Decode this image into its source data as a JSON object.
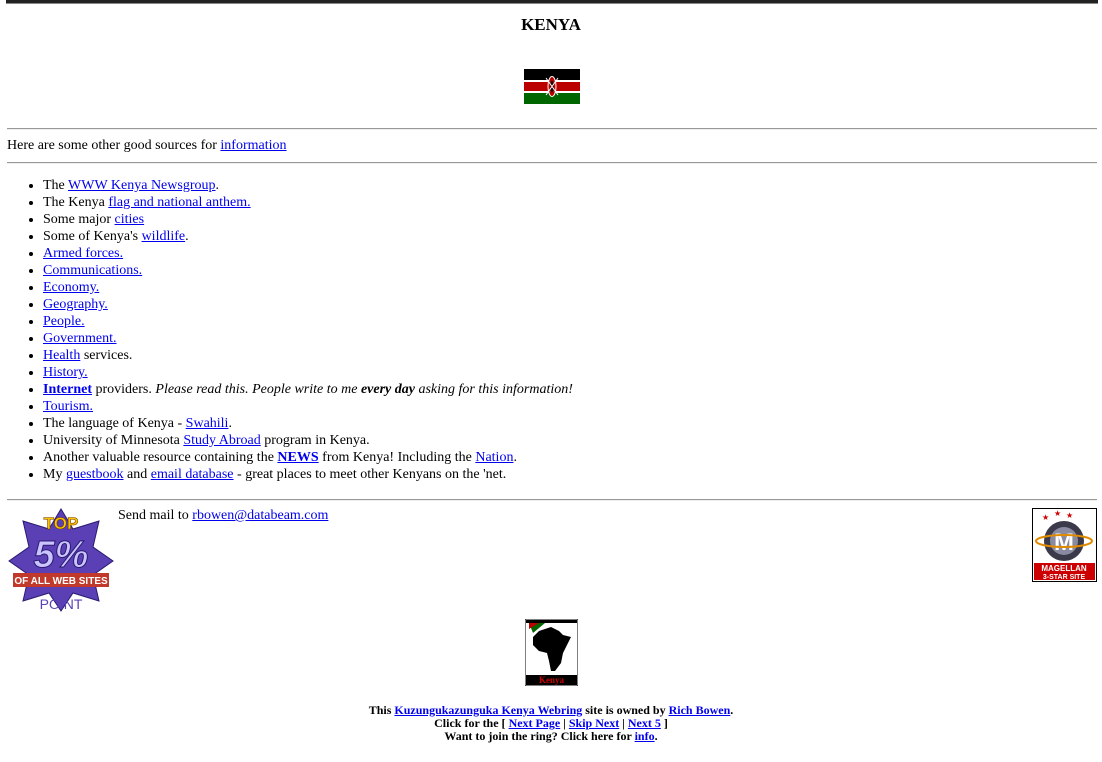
{
  "page": {
    "title": "KENYA"
  },
  "intro": {
    "text": "Here are some other good sources for ",
    "link": "information"
  },
  "sources": {
    "item1": {
      "pre": "The ",
      "link": "WWW Kenya Newsgroup",
      "post": "."
    },
    "item2": {
      "pre": "The Kenya ",
      "link": "flag and national anthem."
    },
    "item3": {
      "pre": "Some major ",
      "link": "cities"
    },
    "item4": {
      "pre": "Some of Kenya's ",
      "link": "wildlife",
      "post": "."
    },
    "item5": {
      "link": "Armed forces."
    },
    "item6": {
      "link": "Communications."
    },
    "item7": {
      "link": "Economy."
    },
    "item8": {
      "link": "Geography."
    },
    "item9": {
      "link": "People."
    },
    "item10": {
      "link": "Government."
    },
    "item11": {
      "link": "Health",
      "post": " services."
    },
    "item12": {
      "link": "History."
    },
    "item13": {
      "link": "Internet",
      "post": " providers. ",
      "italic1": "Please read this. People write to me ",
      "bold_italic": "every day",
      "italic2": " asking for this information!"
    },
    "item14": {
      "link": "Tourism."
    },
    "item15": {
      "pre": "The language of Kenya - ",
      "link": "Swahili",
      "post": "."
    },
    "item16": {
      "pre": "University of Minnesota ",
      "link": "Study Abroad",
      "post": " program in Kenya."
    },
    "item17": {
      "pre": "Another valuable resource containing the ",
      "link": "NEWS",
      "mid": " from Kenya! Including the ",
      "link2": "Nation",
      "post": "."
    },
    "item18": {
      "pre": "My ",
      "link": "guestbook",
      "mid": " and ",
      "link2": "email database",
      "post": " - great places to meet other Kenyans on the 'net."
    }
  },
  "contact": {
    "text": "Send mail to ",
    "email": "rbowen@databeam.com"
  },
  "badges": {
    "top5_line1": "TOP",
    "top5_line2": "5%",
    "top5_line3": "OF ALL WEB SITES",
    "top5_line4": "POINT",
    "magellan_line1": "MAGELLAN",
    "magellan_line2": "3-STAR SITE",
    "africa_label": "Kenya"
  },
  "footer": {
    "line1_pre": "This ",
    "ring_link": "Kuzungukazunguka Kenya Webring",
    "line1_mid": " site is owned by ",
    "owner_link": "Rich Bowen",
    "line1_post": ".",
    "line2_pre": "Click for the [ ",
    "next_page": "Next Page",
    "sep": " | ",
    "skip_next": "Skip Next",
    "next5": "Next 5",
    "line2_post": " ]",
    "line3_pre": "Want to join the ring? Click here for ",
    "info_link": "info",
    "line3_post": "."
  },
  "colors": {
    "link": "#0000ee",
    "flag_black": "#000000",
    "flag_red": "#bb0000",
    "flag_green": "#006600",
    "badge_purple": "#5a3fb5"
  }
}
